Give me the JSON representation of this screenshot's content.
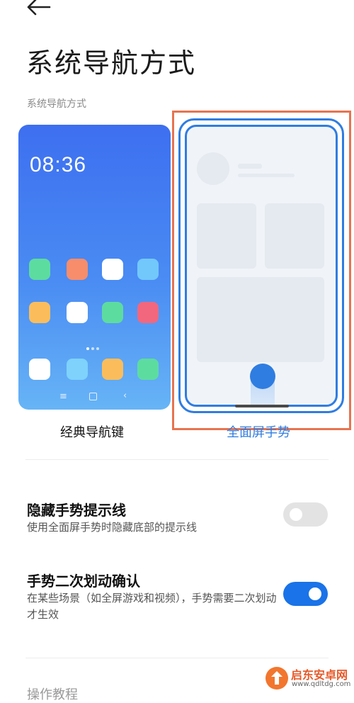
{
  "header": {
    "back_icon": "arrow-left-icon",
    "title": "系统导航方式"
  },
  "section": {
    "label": "系统导航方式"
  },
  "options": {
    "classic": {
      "label": "经典导航键",
      "clock": "08:36",
      "selected": false
    },
    "gesture": {
      "label": "全面屏手势",
      "selected": true
    }
  },
  "settings": [
    {
      "title": "隐藏手势提示线",
      "desc": "使用全面屏手势时隐藏底部的提示线",
      "enabled": false
    },
    {
      "title": "手势二次划动确认",
      "desc": "在某些场景（如全屏游戏和视频），手势需要二次划动才生效",
      "enabled": true
    }
  ],
  "footer": {
    "partial_label": "操作教程"
  },
  "watermark": {
    "brand": "启东安卓网",
    "url": "www.qdltdg.com"
  },
  "colors": {
    "accent": "#2f7de1",
    "highlight": "#e8734f",
    "toggle_on": "#1a73e8",
    "toggle_off": "#e3e3e3"
  }
}
